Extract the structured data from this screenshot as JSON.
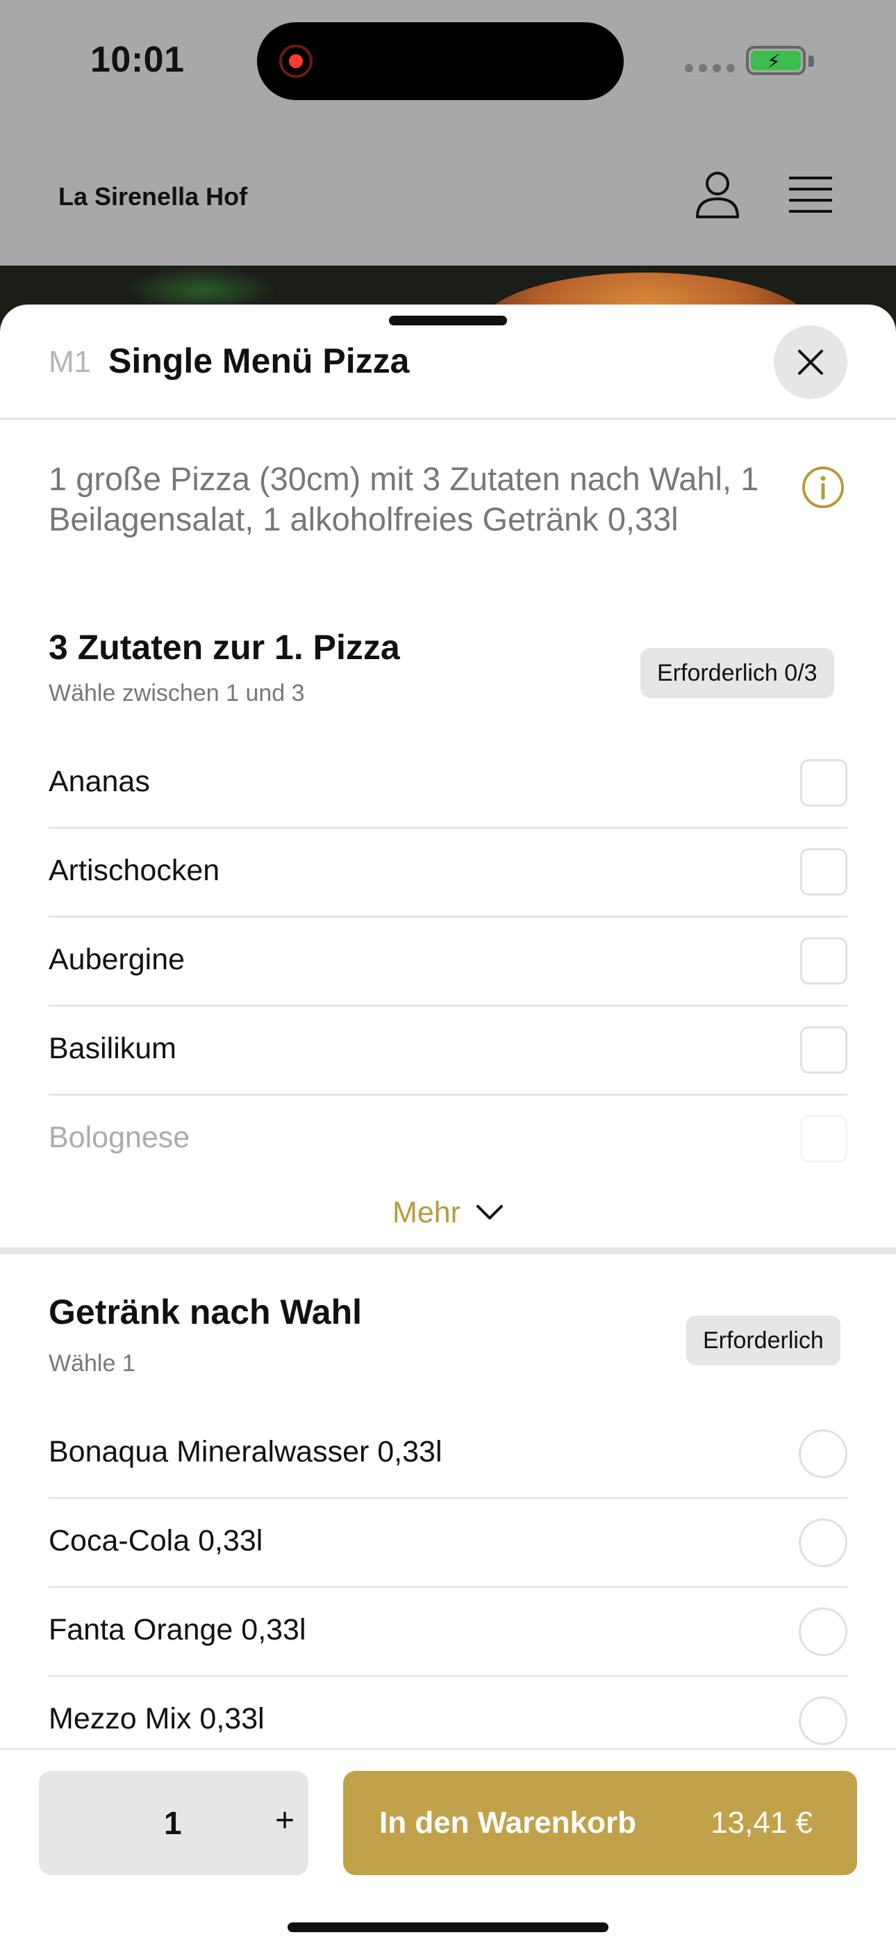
{
  "status_bar": {
    "time": "10:01"
  },
  "header": {
    "brand": "La Sirenella Hof",
    "user_icon": "user-icon",
    "menu_icon": "hamburger-menu-icon"
  },
  "item": {
    "code": "M1",
    "title": "Single Menü Pizza",
    "description": "1 große Pizza (30cm) mit 3 Zutaten nach Wahl, 1 Beilagensalat, 1 alkoholfreies Getränk 0,33l"
  },
  "group_toppings": {
    "title": "3 Zutaten zur 1. Pizza",
    "subtitle": "Wähle zwischen 1 und 3",
    "badge": "Erforderlich 0/3",
    "options": [
      {
        "label": "Ananas"
      },
      {
        "label": "Artischocken"
      },
      {
        "label": "Aubergine"
      },
      {
        "label": "Basilikum"
      },
      {
        "label": "Bolognese"
      }
    ],
    "more_label": "Mehr"
  },
  "group_drinks": {
    "title": "Getränk nach Wahl",
    "subtitle": "Wähle 1",
    "badge": "Erforderlich",
    "options": [
      {
        "label": "Bonaqua Mineralwasser 0,33l"
      },
      {
        "label": "Coca-Cola 0,33l"
      },
      {
        "label": "Fanta Orange 0,33l"
      },
      {
        "label": "Mezzo Mix 0,33l"
      }
    ]
  },
  "footer": {
    "quantity": "1",
    "plus_label": "+",
    "cart_label": "In den Warenkorb",
    "price": "13,41 €"
  },
  "colors": {
    "accent": "#c1a24a",
    "accent_text": "#b89b3c",
    "divider": "#e6e6e6"
  }
}
